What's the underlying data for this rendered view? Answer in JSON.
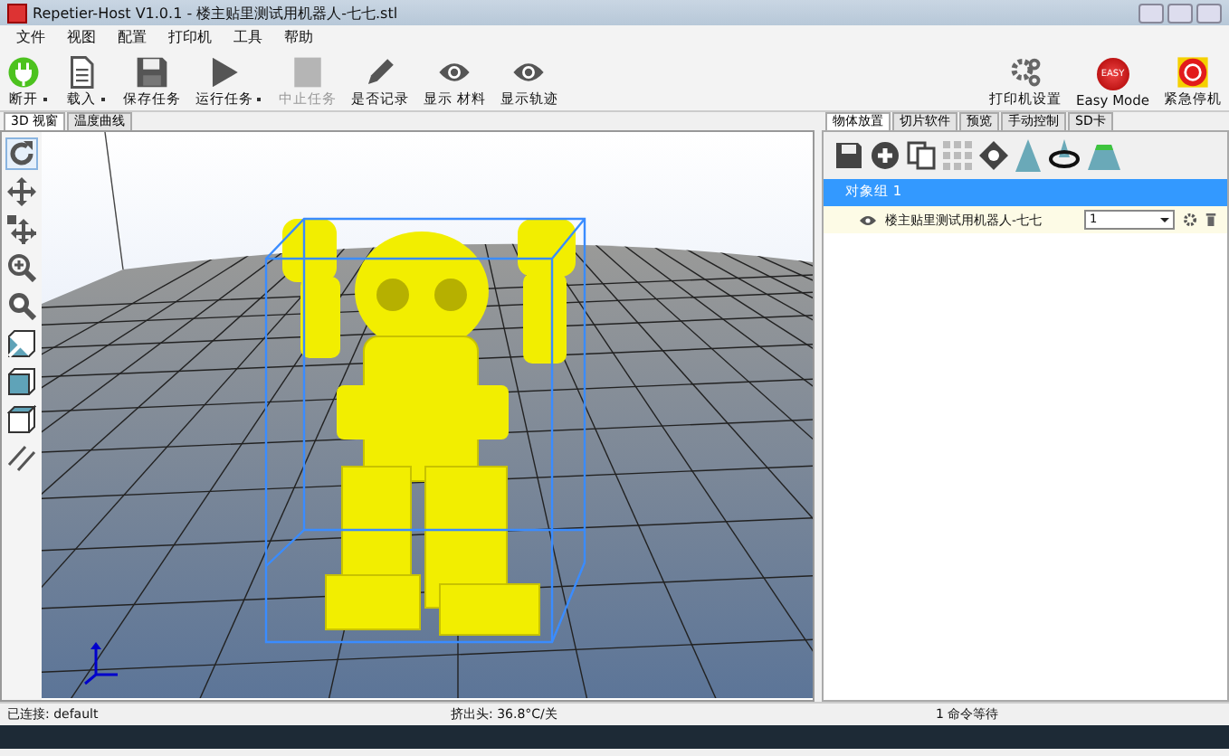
{
  "window": {
    "title": "Repetier-Host V1.0.1 - 楼主贴里测试用机器人-七七.stl"
  },
  "menu": [
    "文件",
    "视图",
    "配置",
    "打印机",
    "工具",
    "帮助"
  ],
  "toolbar": [
    {
      "kind": "power",
      "label": "断开",
      "dropdown": true,
      "disabled": false
    },
    {
      "kind": "file",
      "label": "载入",
      "dropdown": true,
      "disabled": false
    },
    {
      "kind": "save",
      "label": "保存任务",
      "dropdown": false,
      "disabled": false
    },
    {
      "kind": "play",
      "label": "运行任务",
      "dropdown": true,
      "disabled": false
    },
    {
      "kind": "stop",
      "label": "中止任务",
      "dropdown": false,
      "disabled": true
    },
    {
      "kind": "pencil",
      "label": "是否记录",
      "dropdown": false,
      "disabled": false
    },
    {
      "kind": "eye",
      "label": "显示 材料",
      "dropdown": false,
      "disabled": false
    },
    {
      "kind": "eye",
      "label": "显示轨迹",
      "dropdown": false,
      "disabled": false
    }
  ],
  "toolbar_right": [
    {
      "kind": "gears",
      "label": "打印机设置"
    },
    {
      "kind": "easy",
      "label": "Easy Mode",
      "badge": "EASY"
    },
    {
      "kind": "estop",
      "label": "紧急停机"
    }
  ],
  "view_tabs": [
    {
      "label": "3D 视窗",
      "selected": true
    },
    {
      "label": "温度曲线",
      "selected": false
    }
  ],
  "view_tools": [
    {
      "kind": "rotate",
      "selected": true
    },
    {
      "kind": "move",
      "selected": false
    },
    {
      "kind": "move-object",
      "selected": false
    },
    {
      "kind": "zoom",
      "selected": false
    },
    {
      "kind": "fit",
      "selected": false
    },
    {
      "kind": "iso",
      "selected": false
    },
    {
      "kind": "front",
      "selected": false
    },
    {
      "kind": "top",
      "selected": false
    },
    {
      "kind": "parallel",
      "selected": false
    }
  ],
  "panel_tabs": [
    {
      "label": "物体放置",
      "selected": true
    },
    {
      "label": "切片软件",
      "selected": false
    },
    {
      "label": "预览",
      "selected": false
    },
    {
      "label": "手动控制",
      "selected": false
    },
    {
      "label": "SD卡",
      "selected": false
    }
  ],
  "panel_tools": [
    {
      "kind": "save"
    },
    {
      "kind": "add"
    },
    {
      "kind": "copy"
    },
    {
      "kind": "grid"
    },
    {
      "kind": "center"
    },
    {
      "kind": "cone"
    },
    {
      "kind": "rotate"
    },
    {
      "kind": "cut"
    }
  ],
  "object_group": {
    "title": "对象组 1",
    "objects": [
      {
        "name": "楼主贴里测试用机器人-七七",
        "copies": "1",
        "visible": true
      }
    ]
  },
  "status_bar": {
    "connection": "已连接: default",
    "extruder": "挤出头: 36.8°C/关",
    "queue": "1 命令等待"
  }
}
